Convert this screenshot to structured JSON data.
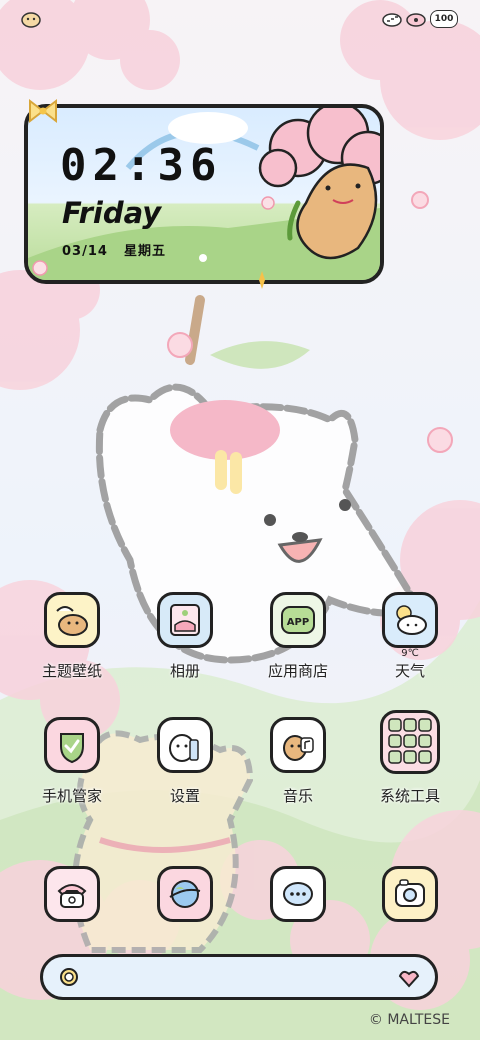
{
  "status_bar": {
    "battery": "100"
  },
  "clock_widget": {
    "time": "02:36",
    "day": "Friday",
    "date": "03/14",
    "weekday": "星期五"
  },
  "apps": [
    {
      "label": "主题壁纸",
      "icon": "theme-wallpaper-icon"
    },
    {
      "label": "相册",
      "icon": "gallery-icon"
    },
    {
      "label": "应用商店",
      "icon": "app-store-icon",
      "badge": "APP"
    },
    {
      "label": "天气",
      "icon": "weather-icon",
      "temperature": "9℃"
    },
    {
      "label": "手机管家",
      "icon": "phone-manager-icon"
    },
    {
      "label": "设置",
      "icon": "settings-icon"
    },
    {
      "label": "音乐",
      "icon": "music-icon"
    },
    {
      "label": "系统工具",
      "icon": "system-tools-folder-icon"
    }
  ],
  "dock": [
    {
      "icon": "phone-icon"
    },
    {
      "icon": "browser-icon"
    },
    {
      "icon": "messages-icon"
    },
    {
      "icon": "camera-icon"
    }
  ],
  "watermark": "© MALTESE",
  "colors": {
    "outline": "#222222",
    "pink": "#f6c9d4",
    "sky": "#d9ecff",
    "grass": "#b9dc9a",
    "cream": "#fdf1c6"
  }
}
